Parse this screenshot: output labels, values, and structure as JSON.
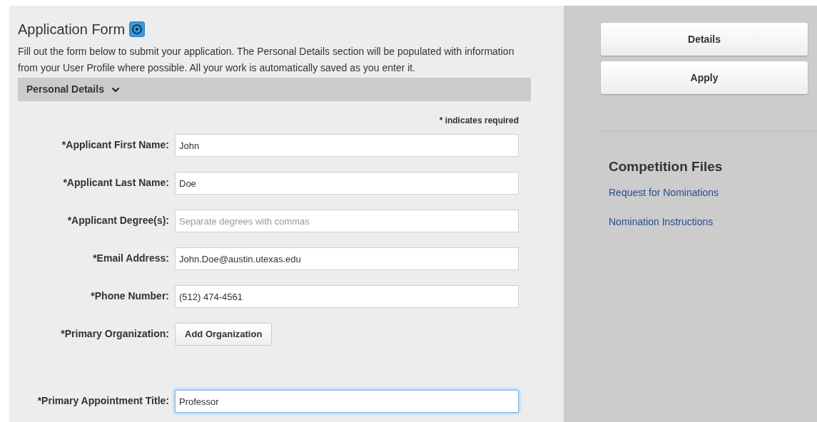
{
  "form": {
    "title": "Application Form",
    "intro": "Fill out the form below to submit your application. The Personal Details section will be populated with information from your User Profile where possible. All your work is automatically saved as you enter it.",
    "section": {
      "title": "Personal Details",
      "expanded": true
    },
    "required_note": "* indicates required",
    "fields": [
      {
        "kind": "text",
        "label": "*Applicant First Name:",
        "value": "John",
        "focused": false
      },
      {
        "kind": "text",
        "label": "*Applicant Last Name:",
        "value": "Doe",
        "focused": false
      },
      {
        "kind": "text",
        "label": "*Applicant Degree(s):",
        "placeholder": "Separate degrees with commas",
        "focused": false
      },
      {
        "kind": "text",
        "label": "*Email Address:",
        "value": "John.Doe@austin.utexas.edu",
        "focused": false
      },
      {
        "kind": "text",
        "label": "*Phone Number:",
        "value": "(512) 474-4561",
        "focused": false
      },
      {
        "kind": "button",
        "label": "*Primary Organization:",
        "button": "Add Organization"
      },
      {
        "kind": "text",
        "label": "*Primary Appointment Title:",
        "value": "Professor",
        "focused": true
      }
    ]
  },
  "sidebar": {
    "buttons": [
      "Details",
      "Apply"
    ],
    "files_title": "Competition Files",
    "links": [
      "Request for Nominations",
      "Nomination Instructions"
    ]
  }
}
